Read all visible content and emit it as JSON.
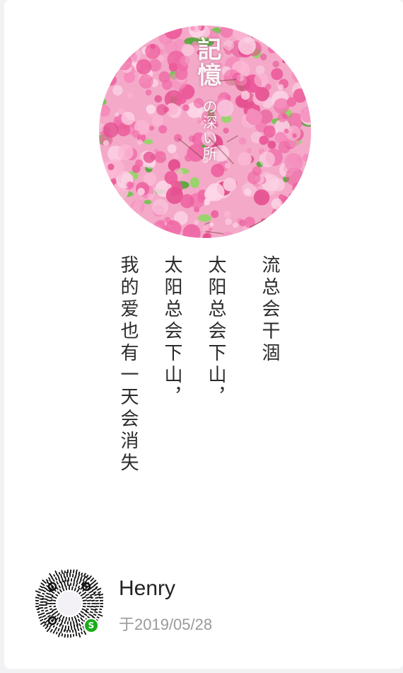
{
  "photo": {
    "title_text": "記憶",
    "subtitle_text": "の深い所"
  },
  "poem": {
    "lines": [
      "流总会干涸",
      "太阳总会下山，",
      "太阳总会下山，",
      "我的爱也有一天会消失"
    ]
  },
  "footer": {
    "author": "Henry",
    "date": "于2019/05/28"
  },
  "icons": {
    "qr": "mini-program-code-icon",
    "badge": "mini-program-logo-icon"
  }
}
